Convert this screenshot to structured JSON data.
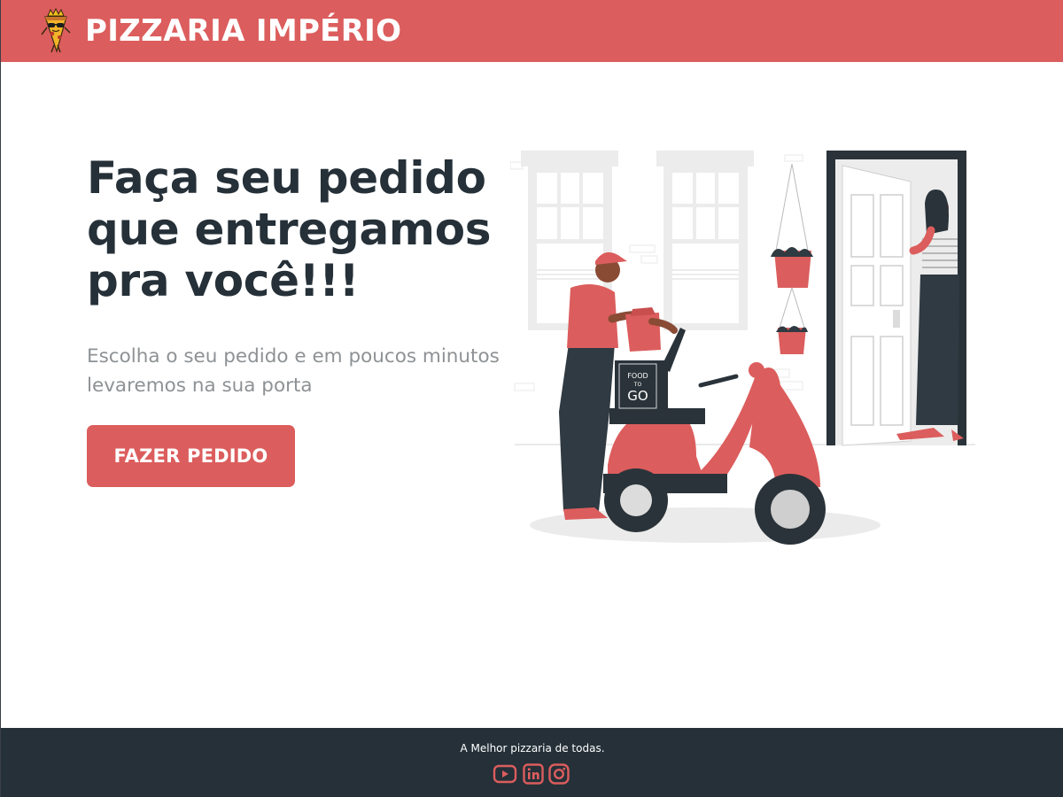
{
  "header": {
    "brand": "PIZZARIA IMPÉRIO",
    "logo_icon": "pizza-king-mascot-icon"
  },
  "hero": {
    "title_line1": "Faça seu pedido",
    "title_line2": "que entregamos",
    "title_line3": "pra você!!!",
    "subtitle_line1": "Escolha o seu pedido e em poucos minutos",
    "subtitle_line2": "levaremos na sua porta",
    "cta_label": "FAZER PEDIDO",
    "illustration": {
      "name": "delivery-scooter-illustration",
      "box_text_1": "FOOD",
      "box_text_2": "TO",
      "box_text_3": "GO"
    }
  },
  "footer": {
    "tagline": "A Melhor pizzaria de todas.",
    "social": [
      "youtube-icon",
      "linkedin-icon",
      "instagram-icon"
    ]
  },
  "colors": {
    "accent": "#dc5d5d",
    "dark": "#253038",
    "muted_text": "#8e9295"
  }
}
